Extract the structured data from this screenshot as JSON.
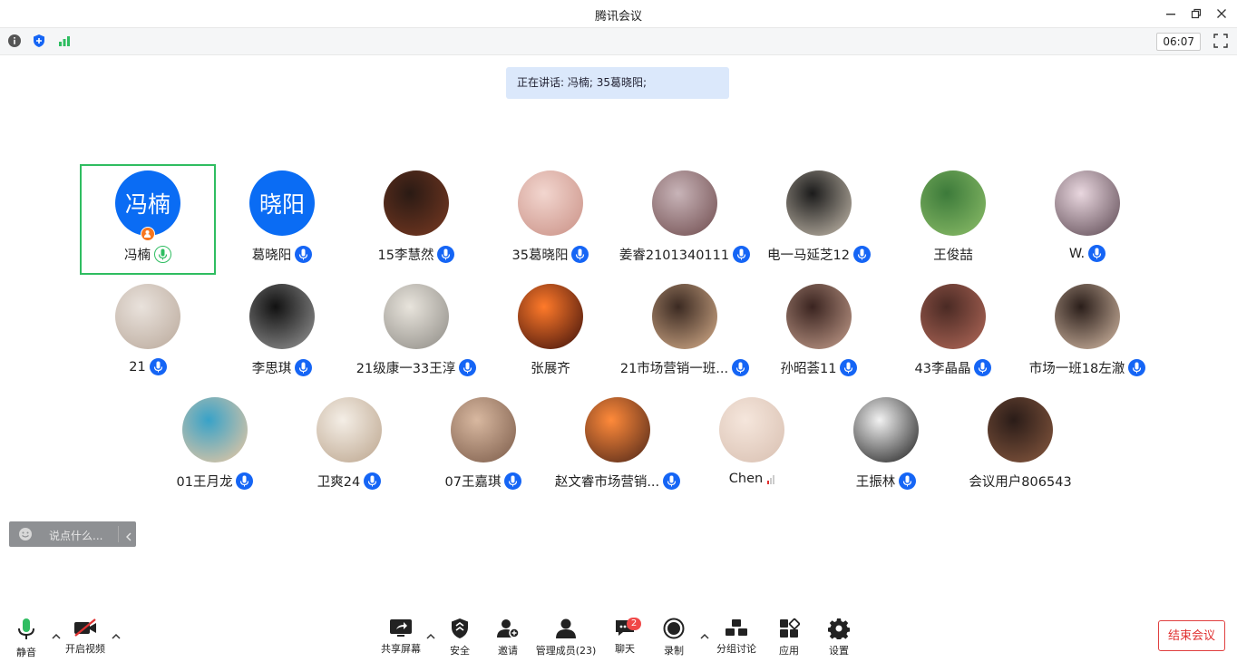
{
  "window": {
    "title": "腾讯会议"
  },
  "infobar": {
    "timer": "06:07"
  },
  "speaking": {
    "label": "正在讲话:",
    "names": "冯楠; 35葛晓阳;"
  },
  "participants": [
    {
      "name": "冯楠",
      "avatar_text": "冯楠",
      "active": true,
      "mic": "speaking"
    },
    {
      "name": "葛晓阳",
      "avatar_text": "晓阳",
      "mic": "on"
    },
    {
      "name": "15李慧然",
      "mic": "on"
    },
    {
      "name": "35葛晓阳",
      "mic": "on"
    },
    {
      "name": "姜睿2101340111",
      "mic": "on"
    },
    {
      "name": "电一马延芝12",
      "mic": "on"
    },
    {
      "name": "王俊喆",
      "mic": "none"
    },
    {
      "name": "W.",
      "mic": "on"
    },
    {
      "name": "21",
      "mic": "on"
    },
    {
      "name": "李思琪",
      "mic": "on"
    },
    {
      "name": "21级康一33王淳",
      "mic": "on"
    },
    {
      "name": "张展齐",
      "mic": "none"
    },
    {
      "name": "21市场营销一班...",
      "mic": "on"
    },
    {
      "name": "孙昭荟11",
      "mic": "on"
    },
    {
      "name": "43李晶晶",
      "mic": "on"
    },
    {
      "name": "市场一班18左澈",
      "mic": "on"
    },
    {
      "name": "01王月龙",
      "mic": "on"
    },
    {
      "name": "卫爽24",
      "mic": "on"
    },
    {
      "name": "07王嘉琪",
      "mic": "on"
    },
    {
      "name": "赵文睿市场营销...",
      "mic": "on"
    },
    {
      "name": "Chen",
      "mic": "signal"
    },
    {
      "name": "王振林",
      "mic": "on"
    },
    {
      "name": "会议用户806543",
      "mic": "none"
    }
  ],
  "chat": {
    "placeholder": "说点什么..."
  },
  "toolbar": {
    "mute": "静音",
    "video": "开启视频",
    "share": "共享屏幕",
    "security": "安全",
    "invite": "邀请",
    "members": "管理成员(23)",
    "chat": "聊天",
    "chat_badge": "2",
    "record": "录制",
    "breakout": "分组讨论",
    "apps": "应用",
    "settings": "设置",
    "end": "结束会议"
  },
  "colors": {
    "accent": "#0a6cf4",
    "speaking_green": "#2fbd61",
    "end_red": "#e03030",
    "banner_bg": "#dbe8fb"
  }
}
